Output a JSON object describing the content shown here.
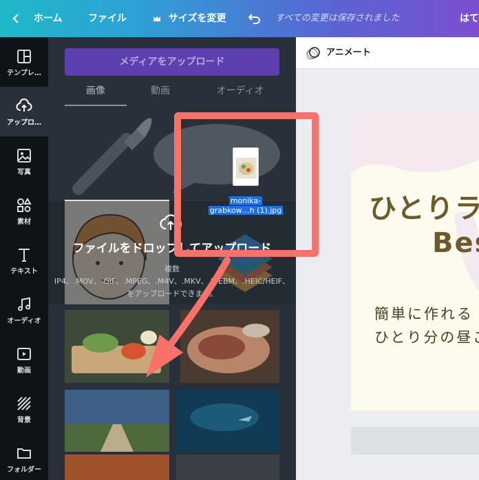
{
  "topbar": {
    "home_label": "ホーム",
    "file_label": "ファイル",
    "resize_label": "サイズを変更",
    "saved_status": "すべての変更は保存されました",
    "right_label": "はて"
  },
  "sidebar": {
    "items": [
      {
        "label": "テンプレ…",
        "icon": "template-icon"
      },
      {
        "label": "アップロ…",
        "icon": "upload-cloud-icon",
        "active": true
      },
      {
        "label": "写真",
        "icon": "photo-icon"
      },
      {
        "label": "素材",
        "icon": "elements-icon"
      },
      {
        "label": "テキスト",
        "icon": "text-icon"
      },
      {
        "label": "オーディオ",
        "icon": "music-icon"
      },
      {
        "label": "動画",
        "icon": "video-icon"
      },
      {
        "label": "背景",
        "icon": "background-icon"
      },
      {
        "label": "フォルダー",
        "icon": "folder-icon"
      }
    ]
  },
  "panel": {
    "upload_button": "メディアをアップロード",
    "tabs": [
      {
        "label": "画像",
        "active": true
      },
      {
        "label": "動画",
        "active": false
      },
      {
        "label": "オーディオ",
        "active": false
      }
    ],
    "drop_message": "ファイルをドロップしてアップロード",
    "drop_sub1": "複数",
    "drop_sub2": "IP4、.MOV、.GIF、.MPEG、.M4V、.MKV、.WEBM、.HEIC/HEIF、",
    "drop_sub3": "をアップロードできます。"
  },
  "drag": {
    "file_name_line1": "monika-",
    "file_name_line2": "grabkow…h (1).jpg"
  },
  "editor": {
    "animate_label": "アニメート",
    "title_line1": "ひとりラ",
    "title_line2": "Bes",
    "subtitle_line1": "簡単に作れる",
    "subtitle_line2": "ひとり分の昼ご"
  },
  "colors": {
    "accent_purple": "#5d3fb0",
    "drag_highlight": "#f8726a",
    "title_brown": "#6b5a2c"
  }
}
